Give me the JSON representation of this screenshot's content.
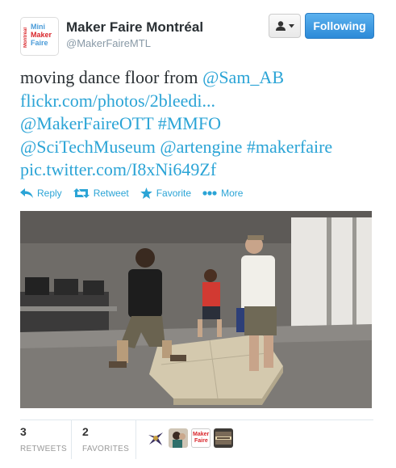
{
  "user": {
    "display_name": "Maker Faire Montréal",
    "handle": "@MakerFaireMTL",
    "avatar": {
      "side_text": "Montréal",
      "line1": "Mini",
      "line2": "Maker",
      "line3": "Faire"
    }
  },
  "buttons": {
    "user_dropdown_icon": "user-icon",
    "follow_label": "Following"
  },
  "tweet": {
    "text_plain": "moving dance floor from ",
    "mention_1": "@Sam_AB",
    "link_1": "flickr.com/photos/2bleedi...",
    "mention_2": "@MakerFaireOTT",
    "hashtag_1": "#MMFO",
    "mention_3": "@SciTechMuseum",
    "mention_4": "@artengine",
    "hashtag_2": "#makerfaire",
    "link_2": "pic.twitter.com/I8xNi649Zf"
  },
  "actions": {
    "reply": "Reply",
    "retweet": "Retweet",
    "favorite": "Favorite",
    "more": "More"
  },
  "stats": {
    "retweets_count": "3",
    "retweets_label": "RETWEETS",
    "favorites_count": "2",
    "favorites_label": "FAVORITES"
  },
  "favoriters": {
    "third_avatar_line1": "Maker",
    "third_avatar_line2": "Faire"
  },
  "colors": {
    "link": "#2ba4d6",
    "follow_button": "#2c8ad8",
    "maker_red": "#d9262b"
  }
}
